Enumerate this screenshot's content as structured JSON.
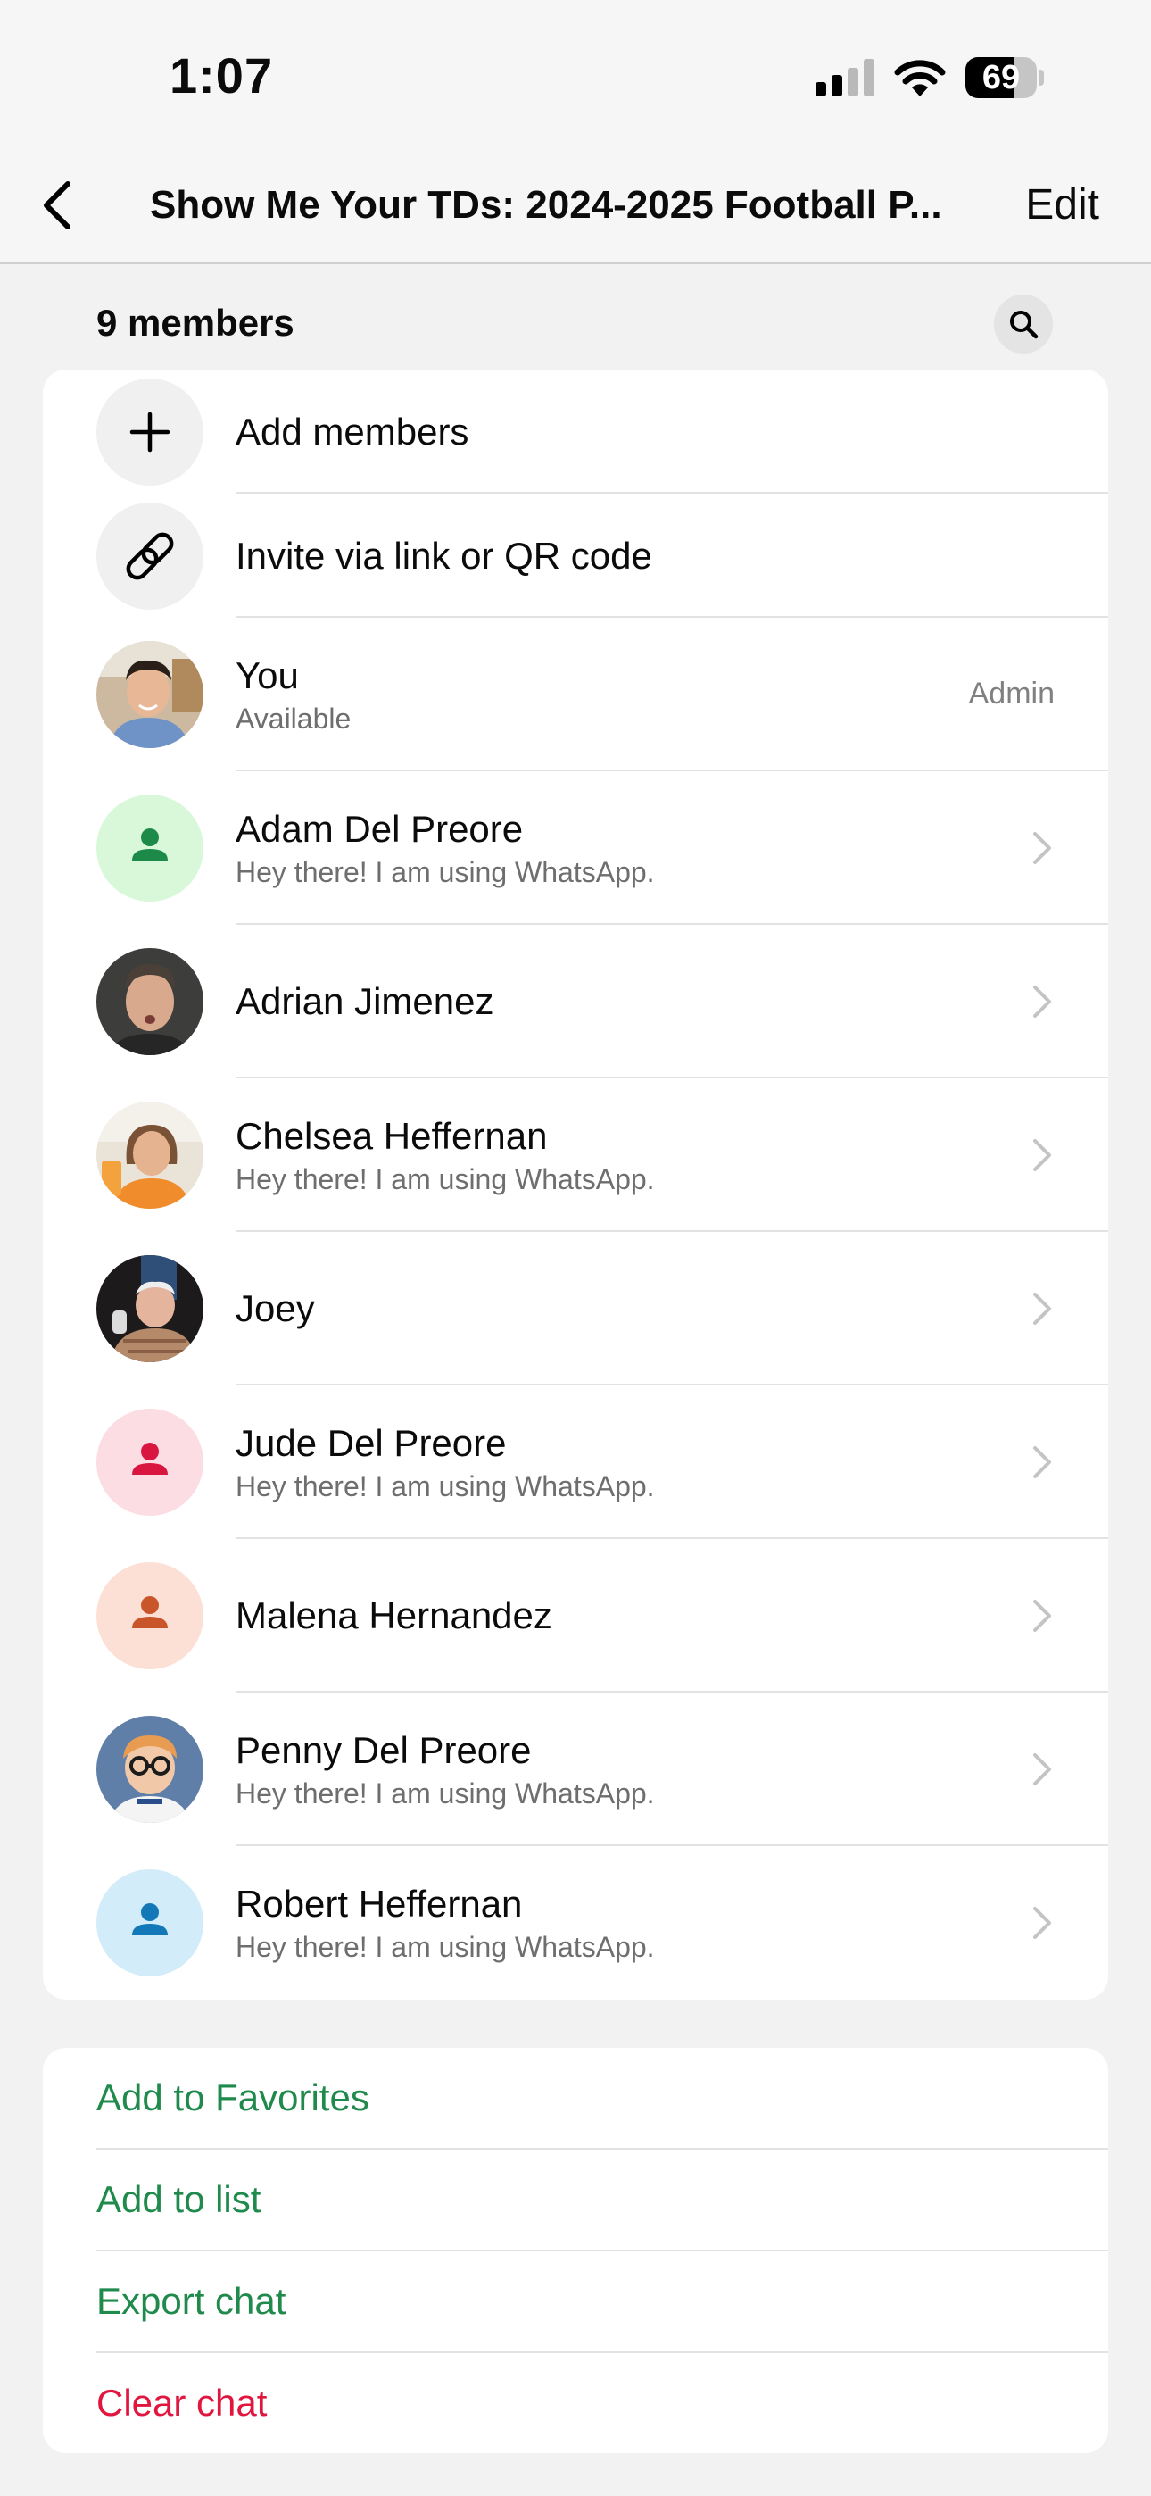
{
  "status_bar": {
    "time": "1:07",
    "battery": "69",
    "battery_level": 0.69
  },
  "nav": {
    "title": "Show Me Your TDs: 2024-2025 Football P...",
    "edit_label": "Edit"
  },
  "members_header": {
    "count_label": "9 members"
  },
  "actions": [
    {
      "label": "Add members",
      "icon": "plus-icon"
    },
    {
      "label": "Invite via link or QR code",
      "icon": "link-icon"
    }
  ],
  "members": [
    {
      "name": "You",
      "status": "Available",
      "role": "Admin",
      "avatar": "photo"
    },
    {
      "name": "Adam Del Preore",
      "status": "Hey there! I am using WhatsApp.",
      "avatar": "placeholder",
      "avatar_bg": "#d9f7d9",
      "avatar_fg": "#1d8a4a"
    },
    {
      "name": "Adrian Jimenez",
      "status": "",
      "avatar": "photo"
    },
    {
      "name": "Chelsea Heffernan",
      "status": "Hey there! I am using WhatsApp.",
      "avatar": "photo"
    },
    {
      "name": "Joey",
      "status": "",
      "avatar": "photo"
    },
    {
      "name": "Jude Del Preore",
      "status": "Hey there! I am using WhatsApp.",
      "avatar": "placeholder",
      "avatar_bg": "#fbdde3",
      "avatar_fg": "#d9163f"
    },
    {
      "name": "Malena Hernandez",
      "status": "",
      "avatar": "placeholder",
      "avatar_bg": "#fce0d6",
      "avatar_fg": "#c9562a"
    },
    {
      "name": "Penny Del Preore",
      "status": "Hey there! I am using WhatsApp.",
      "avatar": "photo"
    },
    {
      "name": "Robert Heffernan",
      "status": "Hey there! I am using WhatsApp.",
      "avatar": "placeholder",
      "avatar_bg": "#d2ecfa",
      "avatar_fg": "#1278b8"
    }
  ],
  "options": [
    {
      "label": "Add to Favorites",
      "color": "#1f8a4c"
    },
    {
      "label": "Add to list",
      "color": "#1f8a4c"
    },
    {
      "label": "Export chat",
      "color": "#1f8a4c"
    },
    {
      "label": "Clear chat",
      "color": "#e0163f"
    }
  ]
}
